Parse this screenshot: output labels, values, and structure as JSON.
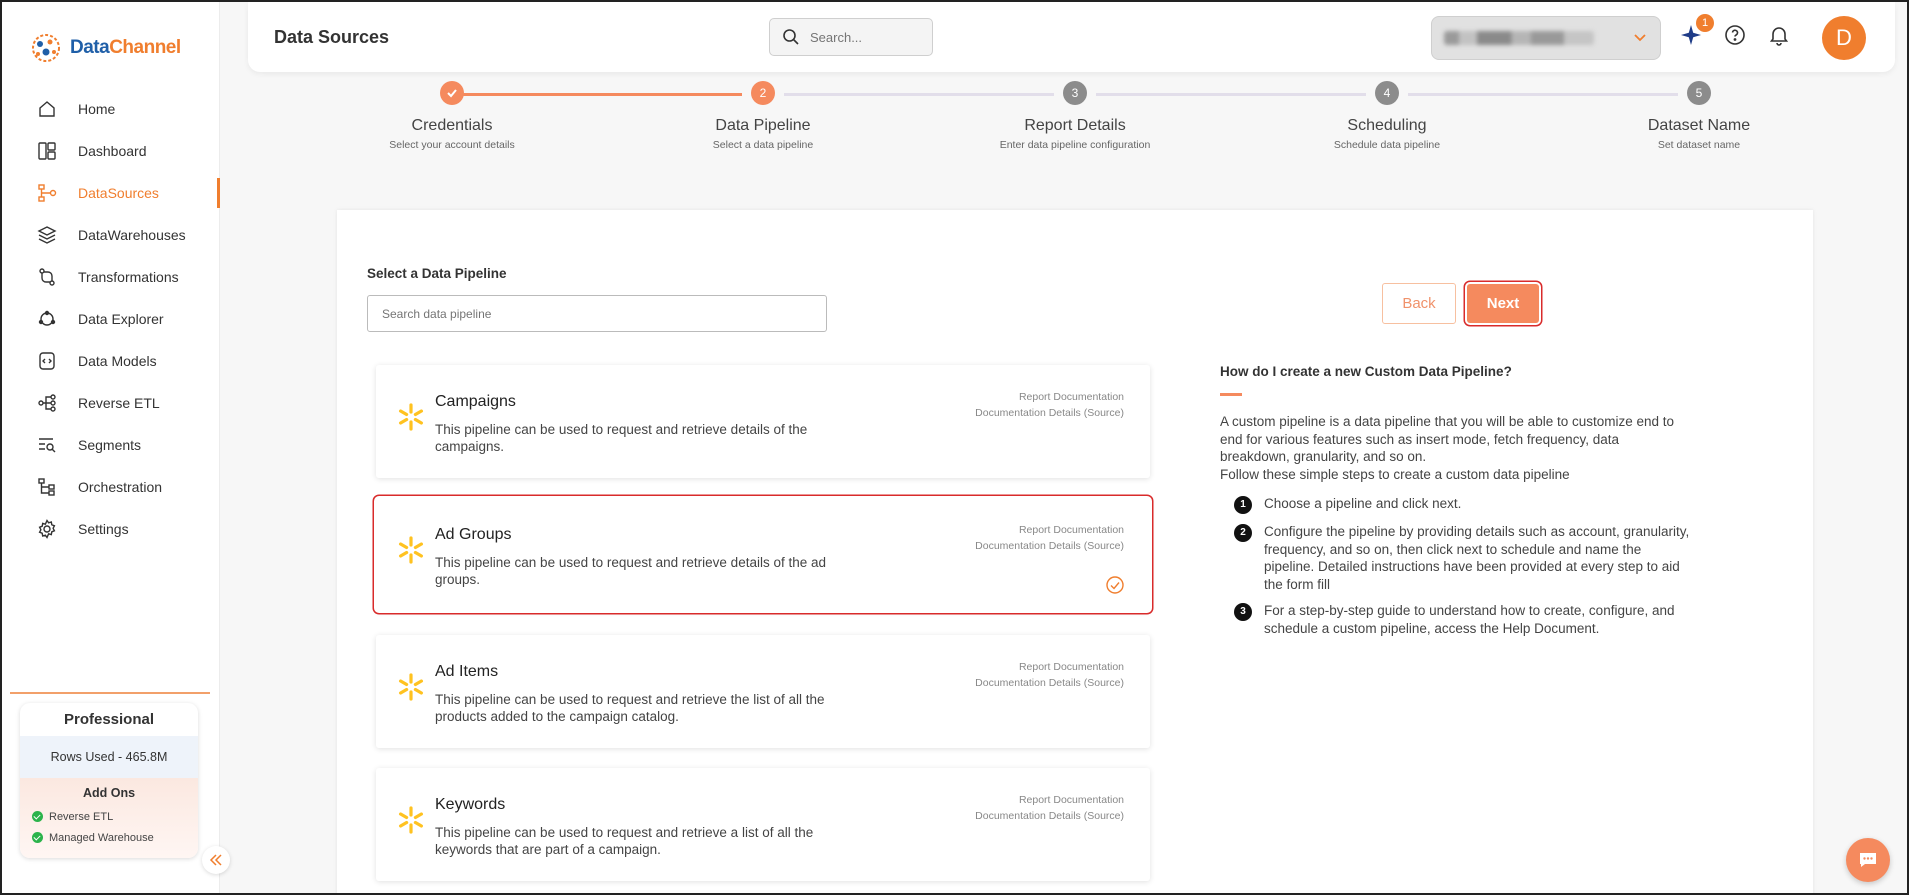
{
  "brand": {
    "part1": "Data",
    "part2": "Channel"
  },
  "sidebar": {
    "items": [
      {
        "label": "Home",
        "icon": "home-icon",
        "active": false
      },
      {
        "label": "Dashboard",
        "icon": "dashboard-icon",
        "active": false
      },
      {
        "label": "DataSources",
        "icon": "datasources-icon",
        "active": true
      },
      {
        "label": "DataWarehouses",
        "icon": "layers-icon",
        "active": false
      },
      {
        "label": "Transformations",
        "icon": "transform-icon",
        "active": false
      },
      {
        "label": "Data Explorer",
        "icon": "explorer-icon",
        "active": false
      },
      {
        "label": "Data Models",
        "icon": "model-icon",
        "active": false
      },
      {
        "label": "Reverse ETL",
        "icon": "share-icon",
        "active": false
      },
      {
        "label": "Segments",
        "icon": "segments-icon",
        "active": false
      },
      {
        "label": "Orchestration",
        "icon": "orchestration-icon",
        "active": false
      },
      {
        "label": "Settings",
        "icon": "gear-icon",
        "active": false
      }
    ],
    "plan": {
      "name": "Professional",
      "rows_used": "Rows Used - 465.8M",
      "addons_title": "Add Ons",
      "addons": [
        "Reverse ETL",
        "Managed Warehouse"
      ]
    }
  },
  "header": {
    "title": "Data Sources",
    "search_placeholder": "Search...",
    "notification_count": "1",
    "avatar_initial": "D"
  },
  "stepper": {
    "steps": [
      {
        "label": "Credentials",
        "sub": "Select your account details",
        "num": "",
        "state": "done"
      },
      {
        "label": "Data Pipeline",
        "sub": "Select a data pipeline",
        "num": "2",
        "state": "current"
      },
      {
        "label": "Report Details",
        "sub": "Enter data pipeline configuration",
        "num": "3",
        "state": "todo"
      },
      {
        "label": "Scheduling",
        "sub": "Schedule data pipeline",
        "num": "4",
        "state": "todo"
      },
      {
        "label": "Dataset Name",
        "sub": "Set dataset name",
        "num": "5",
        "state": "todo"
      }
    ]
  },
  "main": {
    "select_label": "Select a Data Pipeline",
    "search_placeholder": "Search data pipeline",
    "back_label": "Back",
    "next_label": "Next",
    "pipelines": [
      {
        "name": "Campaigns",
        "desc": "This pipeline can be used to request and retrieve details of the campaigns.",
        "link1": "Report Documentation",
        "link2": "Documentation Details (Source)",
        "selected": false
      },
      {
        "name": "Ad Groups",
        "desc": "This pipeline can be used to request and retrieve details of the ad groups.",
        "link1": "Report Documentation",
        "link2": "Documentation Details (Source)",
        "selected": true
      },
      {
        "name": "Ad Items",
        "desc": "This pipeline can be used to request and retrieve the list of all the products added to the campaign catalog.",
        "link1": "Report Documentation",
        "link2": "Documentation Details (Source)",
        "selected": false
      },
      {
        "name": "Keywords",
        "desc": "This pipeline can be used to request and retrieve a list of all the keywords that are part of a campaign.",
        "link1": "Report Documentation",
        "link2": "Documentation Details (Source)",
        "selected": false
      }
    ],
    "help": {
      "title": "How do I create a new Custom Data Pipeline?",
      "para1": "A custom pipeline is a data pipeline that you will be able to customize end to end for various features such as insert mode, fetch frequency, data breakdown, granularity, and so on.",
      "para2": "Follow these simple steps to create a custom data pipeline",
      "steps": [
        {
          "num": "1",
          "text": "Choose a pipeline and click next."
        },
        {
          "num": "2",
          "text": "Configure the pipeline by providing details such as account, granularity, frequency, and so on, then click next to schedule and name the pipeline. Detailed instructions have been provided at every step to aid the form fill"
        },
        {
          "num": "3",
          "text": "For a step-by-step guide to understand how to create, configure, and schedule a custom pipeline, access the Help Document."
        }
      ]
    }
  },
  "colors": {
    "accent": "#f07e2e",
    "selected_outline": "#d92b2b",
    "walmart_spark": "#ffc220"
  }
}
